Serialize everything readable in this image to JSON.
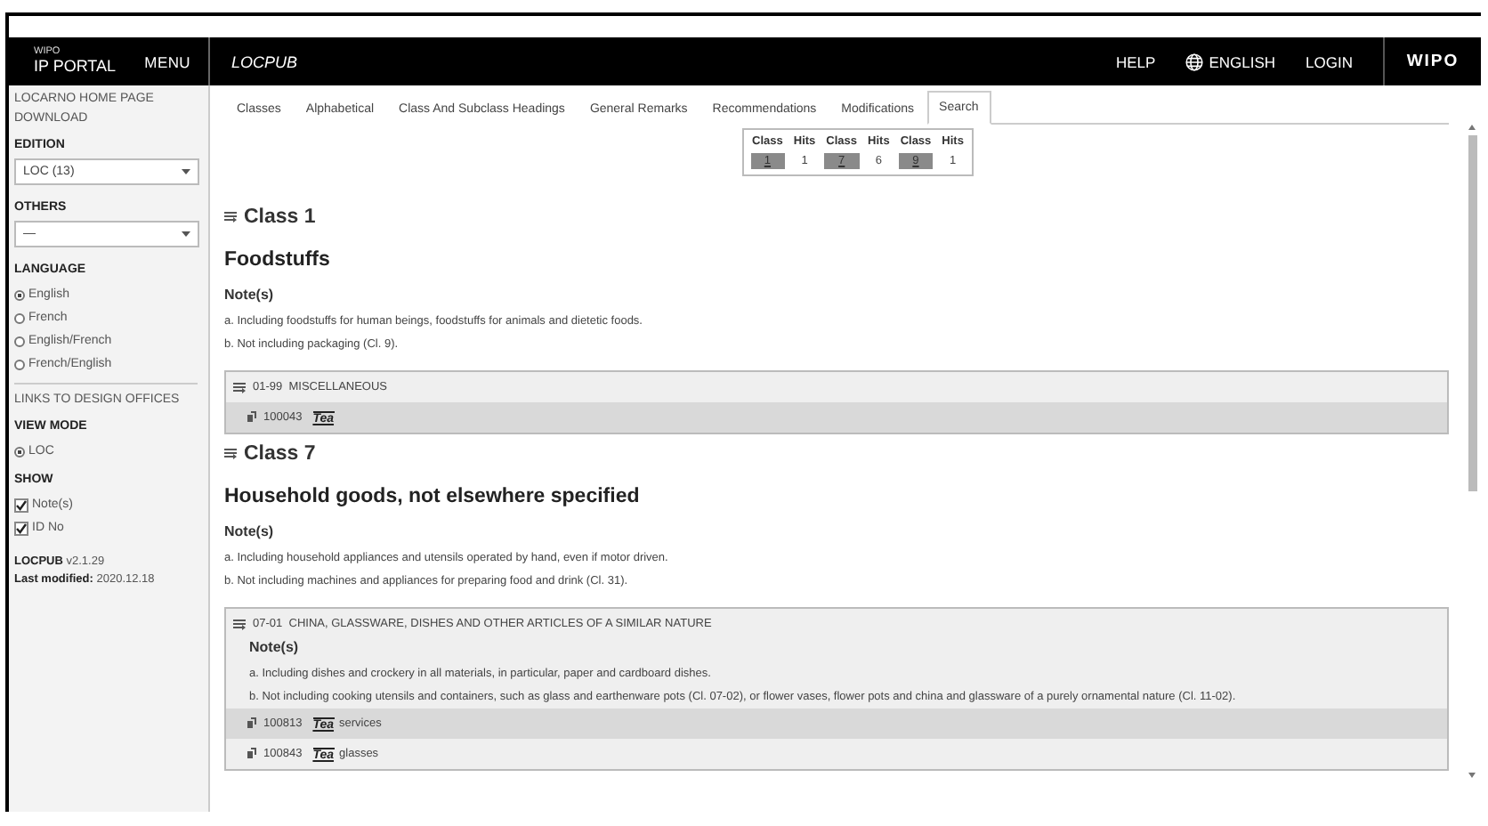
{
  "header": {
    "logo_top": "WIPO",
    "logo_bottom": "IP PORTAL",
    "menu": "MENU",
    "app_title": "LOCPUB",
    "nav": [
      "HELP",
      "ENGLISH",
      "LOGIN"
    ],
    "brand": "WIPO"
  },
  "sidebar": {
    "links": [
      "LOCARNO HOME PAGE",
      "DOWNLOAD"
    ],
    "edition": {
      "label": "EDITION",
      "value": "LOC (13)"
    },
    "others": {
      "label": "OTHERS",
      "value": "—"
    },
    "language": {
      "label": "LANGUAGE",
      "options": [
        {
          "label": "English",
          "selected": true
        },
        {
          "label": "French",
          "selected": false
        },
        {
          "label": "English/French",
          "selected": false
        },
        {
          "label": "French/English",
          "selected": false
        }
      ]
    },
    "design_offices": "LINKS TO DESIGN OFFICES",
    "view_mode": {
      "label": "VIEW MODE",
      "options": [
        {
          "label": "LOC",
          "selected": true
        }
      ]
    },
    "show": {
      "label": "SHOW",
      "options": [
        {
          "label": "Note(s)",
          "checked": true
        },
        {
          "label": "ID No",
          "checked": true
        }
      ]
    },
    "version": "**LOCPUB** v2.1.29",
    "modified": "**Last modified:** 2020.12.18"
  },
  "tabs": [
    {
      "label": "Classes",
      "selected": false
    },
    {
      "label": "Alphabetical",
      "selected": false
    },
    {
      "label": "Class And Subclass Headings",
      "selected": false
    },
    {
      "label": "General Remarks",
      "selected": false
    },
    {
      "label": "Recommendations",
      "selected": false
    },
    {
      "label": "Modifications",
      "selected": false
    },
    {
      "label": "Search",
      "selected": true
    }
  ],
  "hits_table": {
    "columns": [
      "Class",
      "Hits",
      "Class",
      "Hits",
      "Class",
      "Hits"
    ],
    "rows": [
      {
        "class": "1",
        "hits": "1"
      },
      {
        "class": "7",
        "hits": "6"
      },
      {
        "class": "9",
        "hits": "1"
      }
    ]
  },
  "classes": [
    {
      "title": "Class 1",
      "heading": "Foodstuffs",
      "notes_label": "Note(s)",
      "notes": [
        "a. Including foodstuffs for human beings, foodstuffs for animals and dietetic foods.",
        "b. Not including packaging (Cl. 9)."
      ],
      "subclasses": [
        {
          "code": "01-99",
          "title": "MISCELLANEOUS",
          "items": [
            {
              "id": "100043",
              "term": "Tea"
            }
          ]
        }
      ]
    },
    {
      "title": "Class 7",
      "heading": "Household goods, not elsewhere specified",
      "notes_label": "Note(s)",
      "notes": [
        "a. Including household appliances and utensils operated by hand, even if motor driven.",
        "b. Not including machines and appliances for preparing food and drink (Cl. 31)."
      ],
      "subclasses": [
        {
          "code": "07-01",
          "title": "CHINA, GLASSWARE, DISHES AND OTHER ARTICLES OF A SIMILAR NATURE",
          "notes_label": "Note(s)",
          "notes": [
            "a. Including dishes and crockery in all materials, in particular, paper and cardboard dishes.",
            "b. Not including cooking utensils and containers, such as glass and earthenware pots (Cl. 07-02), or flower vases, flower pots and china and glassware of a purely ornamental nature (Cl. 11-02)."
          ],
          "items": [
            {
              "id": "100813",
              "term": "Tea",
              "rest": "services"
            },
            {
              "id": "100843",
              "term": "Tea",
              "rest": "glasses"
            }
          ]
        }
      ]
    }
  ]
}
